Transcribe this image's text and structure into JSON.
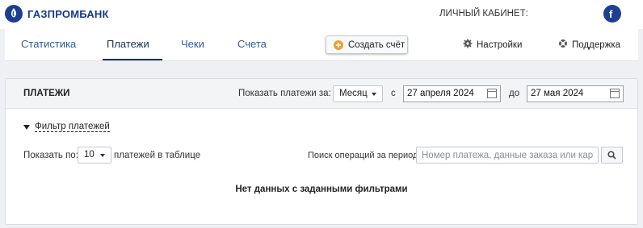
{
  "header": {
    "brand": "ГАЗПРОМБАНК",
    "cabinet_label": "ЛИЧНЫЙ КАБИНЕТ:"
  },
  "nav": {
    "tabs": [
      {
        "label": "Статистика",
        "active": false
      },
      {
        "label": "Платежи",
        "active": true
      },
      {
        "label": "Чеки",
        "active": false
      },
      {
        "label": "Счета",
        "active": false
      }
    ],
    "create_button": "Создать счёт",
    "settings": "Настройки",
    "support": "Поддержка"
  },
  "panel": {
    "title": "ПЛАТЕЖИ",
    "show_label": "Показать платежи за:",
    "period_value": "Месяц",
    "from_label": "с",
    "from_date": "27 апреля 2024",
    "to_label": "до",
    "to_date": "27 мая 2024",
    "filter_label": "Фильтр платежей",
    "per_page_label": "Показать по:",
    "per_page_value": "10",
    "per_page_suffix": "платежей в таблице",
    "search_label": "Поиск операций за период:",
    "search_placeholder": "Номер платежа, данные заказа или карты",
    "empty_message": "Нет данных с заданными фильтрами"
  },
  "colors": {
    "brand_blue": "#1d3f8f",
    "link_blue": "#2b5b9c",
    "accent_orange": "#f0a030"
  },
  "icons": [
    "gazprombank-logo-icon",
    "user-avatar-icon",
    "plus-circle-icon",
    "gear-icon",
    "lifebuoy-icon",
    "calendar-icon",
    "filter-icon",
    "chevron-down-icon",
    "search-icon"
  ]
}
